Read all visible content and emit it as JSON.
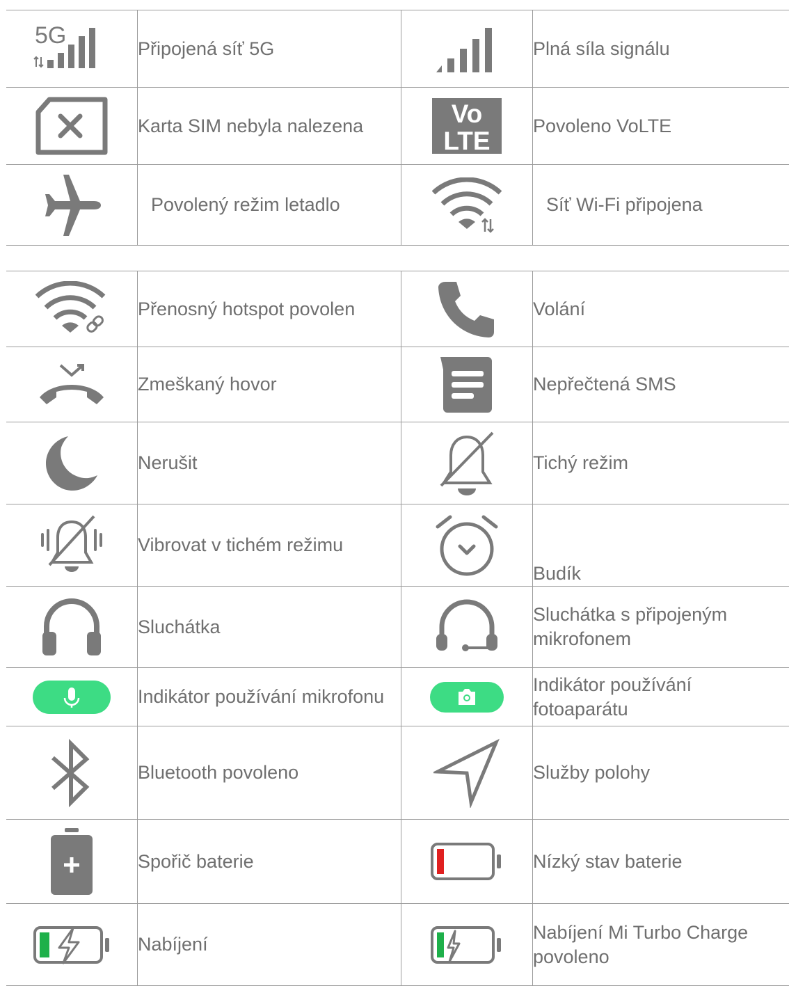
{
  "colors": {
    "icon_gray": "#7a7a7a",
    "indicator_green": "#3ddc84",
    "battery_red": "#e02020",
    "battery_green": "#1eb04a",
    "text": "#6f6f6f"
  },
  "table1": [
    {
      "left_icon": "5g-signal-icon",
      "left_icon_text": "5G",
      "left_label": "Připojená síť 5G",
      "right_icon": "full-signal-icon",
      "right_label": "Plná síla signálu"
    },
    {
      "left_icon": "no-sim-icon",
      "left_label": "Karta SIM nebyla nalezena",
      "right_icon": "volte-icon",
      "right_icon_text_top": "Vo",
      "right_icon_text_bottom": "LTE",
      "right_label": "Povoleno VoLTE"
    },
    {
      "left_icon": "airplane-icon",
      "left_label": "Povolený režim letadlo",
      "right_icon": "wifi-connected-icon",
      "right_label": "Síť Wi-Fi připojena"
    }
  ],
  "table2": [
    {
      "left_icon": "hotspot-icon",
      "left_label": "Přenosný hotspot povolen",
      "right_icon": "phone-call-icon",
      "right_label": "Volání"
    },
    {
      "left_icon": "missed-call-icon",
      "left_label": "Zmeškaný hovor",
      "right_icon": "sms-icon",
      "right_label": "Nepřečtená SMS"
    },
    {
      "left_icon": "moon-icon",
      "left_label": "Nerušit",
      "right_icon": "silent-bell-icon",
      "right_label": "Tichý režim"
    },
    {
      "left_icon": "vibrate-silent-icon",
      "left_label": "Vibrovat v tichém režimu",
      "right_icon": "alarm-clock-icon",
      "right_label": "Budík"
    },
    {
      "left_icon": "headphones-icon",
      "left_label": "Sluchátka",
      "right_icon": "headset-mic-icon",
      "right_label": "Sluchátka s připojeným mikrofonem"
    },
    {
      "left_icon": "mic-indicator-icon",
      "left_label": "Indikátor používání mikrofonu",
      "right_icon": "camera-indicator-icon",
      "right_label": "Indikátor používání fotoaparátu"
    },
    {
      "left_icon": "bluetooth-icon",
      "left_label": "Bluetooth povoleno",
      "right_icon": "location-arrow-icon",
      "right_label": "Služby polohy"
    },
    {
      "left_icon": "battery-saver-icon",
      "left_label": "Spořič baterie",
      "right_icon": "low-battery-icon",
      "right_label": "Nízký stav baterie"
    },
    {
      "left_icon": "charging-icon",
      "left_label": "Nabíjení",
      "right_icon": "turbo-charge-icon",
      "right_label": "Nabíjení Mi Turbo Charge povoleno"
    }
  ]
}
